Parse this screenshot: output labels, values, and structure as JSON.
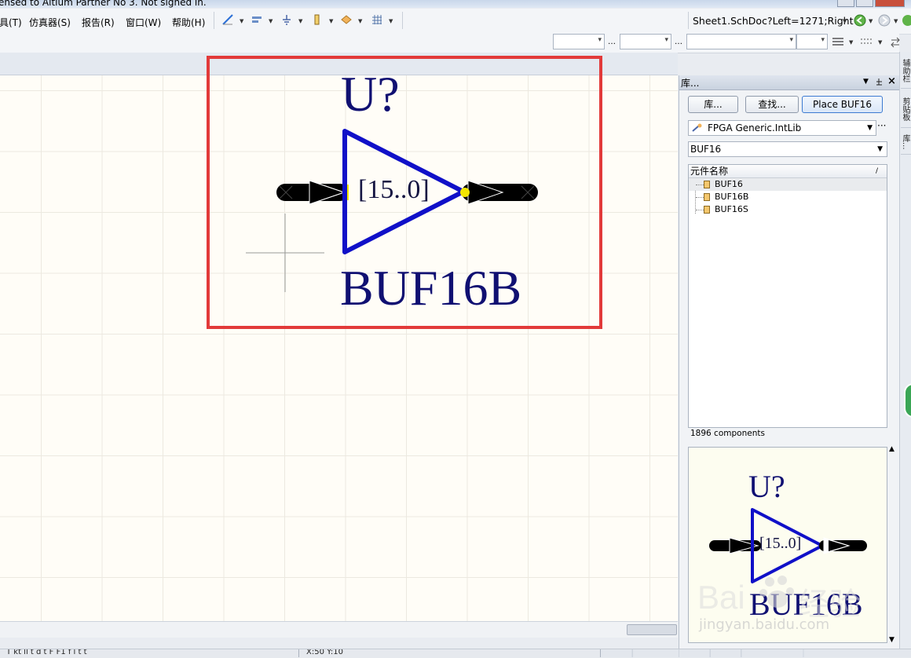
{
  "titlebar": {
    "text": "ensed to Altium Partner No 3. Not signed in."
  },
  "menubar": {
    "items": [
      "具(T)",
      "仿真器(S)",
      "报告(R)",
      "窗口(W)",
      "帮助(H)"
    ],
    "address": "Sheet1.SchDoc?Left=1271;Right"
  },
  "schematic": {
    "designator": "U?",
    "comment": "BUF16B",
    "bus_label": "[15..0]"
  },
  "library_panel": {
    "title": "库...",
    "buttons": {
      "libraries": "库...",
      "search": "查找...",
      "place": "Place BUF16"
    },
    "library": "FPGA Generic.IntLib",
    "filter": "BUF16",
    "column_header": "元件名称",
    "sort_glyph": "/",
    "components": [
      "BUF16",
      "BUF16B",
      "BUF16S"
    ],
    "selected_index": 0,
    "count_text": "1896 components"
  },
  "preview": {
    "designator": "U?",
    "comment": "BUF16B",
    "bus_label": "[15..0]"
  },
  "side_tabs": [
    "辅助栏",
    "剪贴板",
    "库..."
  ],
  "statusbar": {
    "left_text": "T kt      ll t d    t     F     F1 f    l t  t",
    "coords": "X:50 Y:10"
  },
  "watermark": {
    "brand": "Bai",
    "brand2": "经验",
    "url": "jingyan.baidu.com"
  },
  "colors": {
    "symbol_body": "#1010c8",
    "text": "#101072",
    "highlight": "#e23a3a",
    "pin_dot": "#f2e600"
  }
}
